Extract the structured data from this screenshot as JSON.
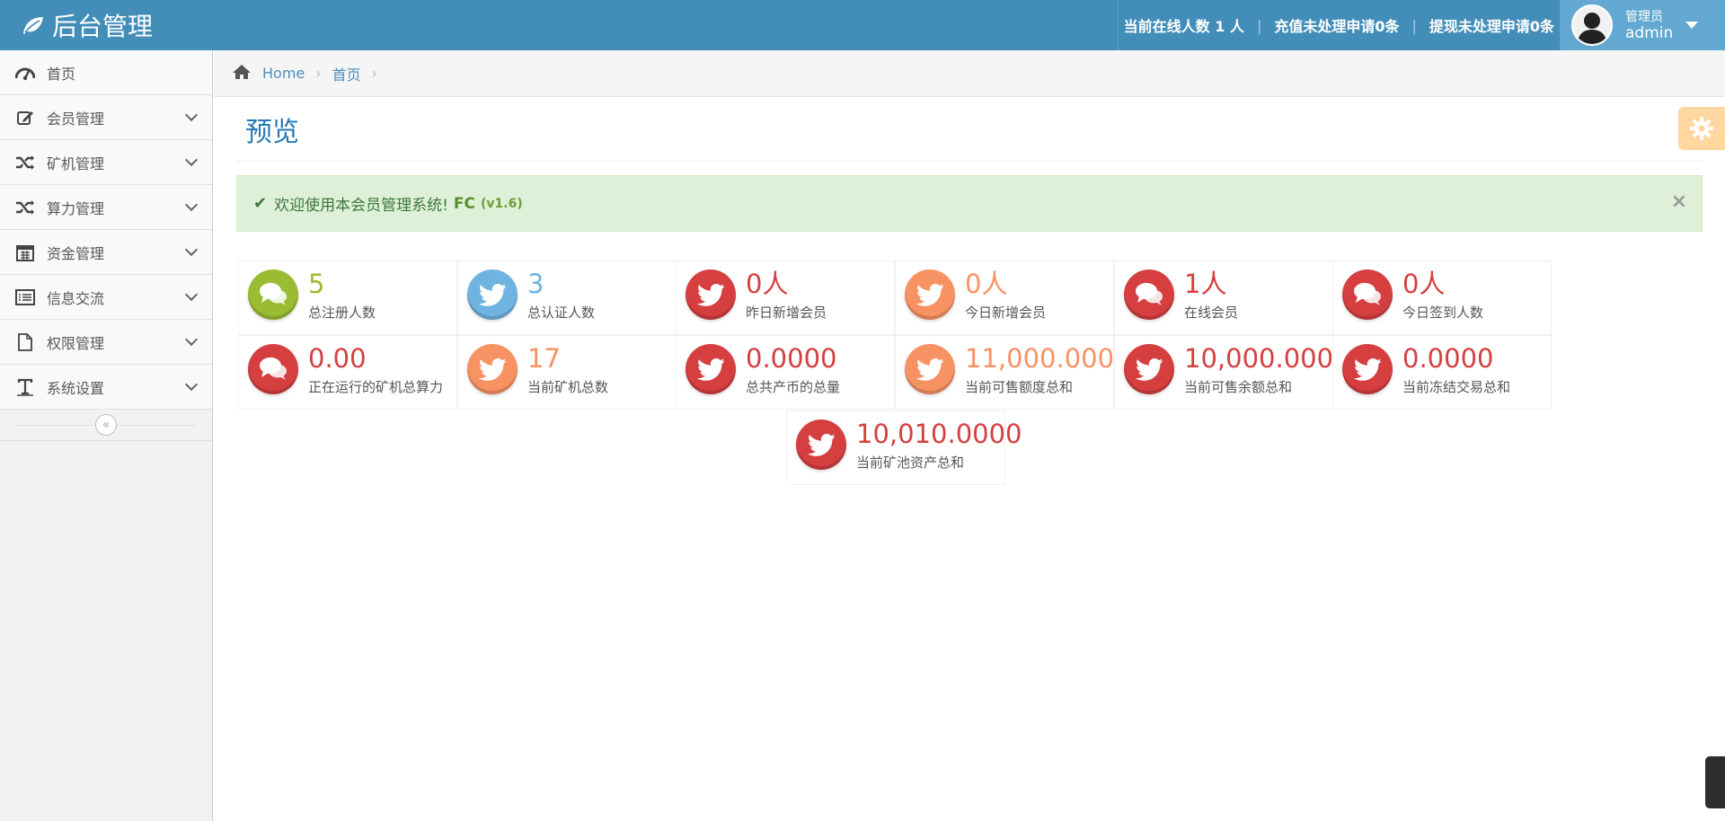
{
  "navbar": {
    "brand": "后台管理",
    "online_text": "当前在线人数 1 人",
    "sep": "|",
    "recharge_text": "充值未处理申请0条",
    "withdraw_text": "提现未处理申请0条",
    "user_role": "管理员",
    "user_name": "admin"
  },
  "sidebar": {
    "items": [
      {
        "label": "首页",
        "icon": "dashboard-icon"
      },
      {
        "label": "会员管理",
        "icon": "edit-icon"
      },
      {
        "label": "矿机管理",
        "icon": "shuffle-icon"
      },
      {
        "label": "算力管理",
        "icon": "shuffle-icon"
      },
      {
        "label": "资金管理",
        "icon": "calendar-icon"
      },
      {
        "label": "信息交流",
        "icon": "list-icon"
      },
      {
        "label": "权限管理",
        "icon": "file-icon"
      },
      {
        "label": "系统设置",
        "icon": "text-icon"
      }
    ],
    "collapse": "«"
  },
  "breadcrumb": {
    "home": "Home",
    "current": "首页",
    "divider": "›"
  },
  "page": {
    "title": "预览"
  },
  "alert": {
    "check": "✔",
    "text": "欢迎使用本会员管理系统!",
    "brand": "FC",
    "version": "(v1.6)",
    "close": "×"
  },
  "infoboxes": [
    {
      "value": "5",
      "label": "总注册人数",
      "color": "#9abc32",
      "icon": "comments-icon"
    },
    {
      "value": "3",
      "label": "总认证人数",
      "color": "#6fb3e0",
      "icon": "twitter-icon"
    },
    {
      "value": "0人",
      "label": "昨日新增会员",
      "color": "#d53f40",
      "icon": "twitter-icon"
    },
    {
      "value": "0人",
      "label": "今日新增会员",
      "color": "#f79263",
      "icon": "twitter-icon"
    },
    {
      "value": "1人",
      "label": "在线会员",
      "color": "#d53f40",
      "icon": "comments-icon"
    },
    {
      "value": "0人",
      "label": "今日签到人数",
      "color": "#d53f40",
      "icon": "comments-icon"
    },
    {
      "value": "0.00",
      "label": "正在运行的矿机总算力",
      "color": "#d53f40",
      "icon": "comments-icon"
    },
    {
      "value": "17",
      "label": "当前矿机总数",
      "color": "#f79263",
      "icon": "twitter-icon"
    },
    {
      "value": "0.0000",
      "label": "总共产币的总量",
      "color": "#d53f40",
      "icon": "twitter-icon"
    },
    {
      "value": "11,000.0000",
      "label": "当前可售额度总和",
      "color": "#f79263",
      "icon": "twitter-icon"
    },
    {
      "value": "10,000.0000",
      "label": "当前可售余额总和",
      "color": "#d53f40",
      "icon": "twitter-icon"
    },
    {
      "value": "0.0000",
      "label": "当前冻结交易总和",
      "color": "#d53f40",
      "icon": "twitter-icon"
    },
    {
      "value": "10,010.0000",
      "label": "当前矿池资产总和",
      "color": "#d53f40",
      "icon": "twitter-icon"
    }
  ]
}
